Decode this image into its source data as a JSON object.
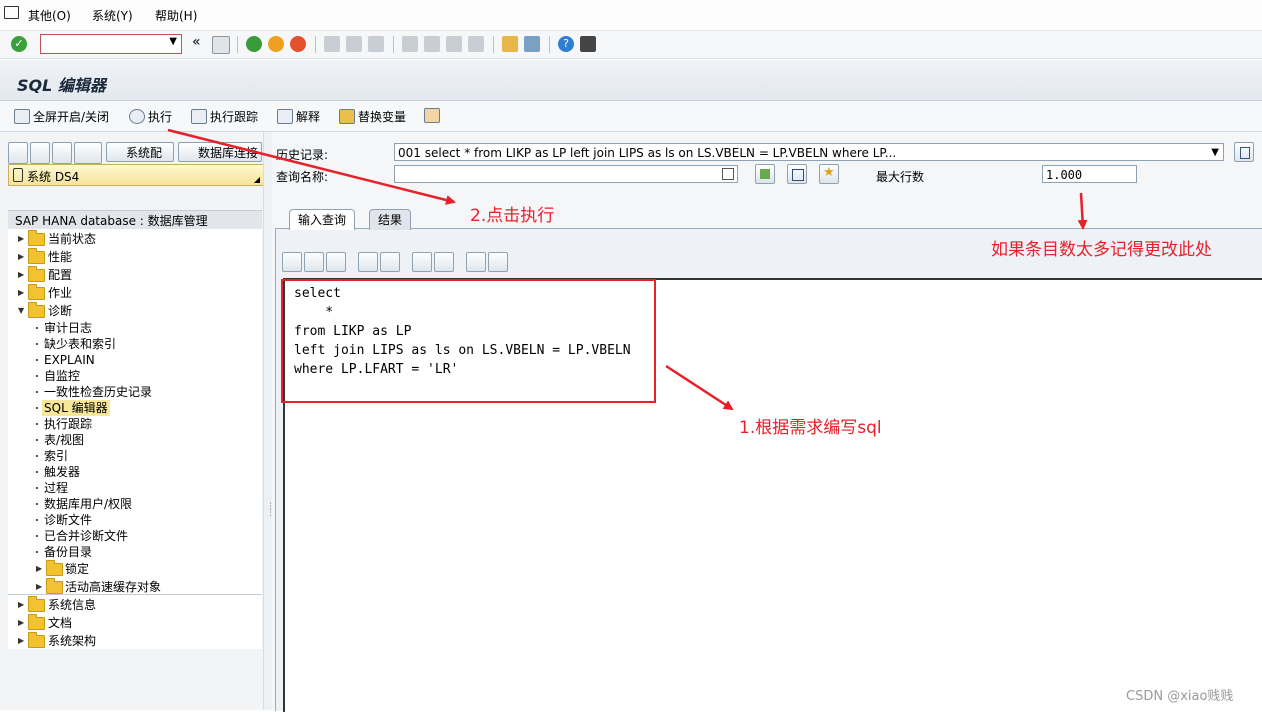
{
  "menu": {
    "items": [
      "其他(O)",
      "系统(Y)",
      "帮助(H)"
    ]
  },
  "command_field": {
    "value": ""
  },
  "title": "SQL 编辑器",
  "app_toolbar": {
    "buttons": [
      "全屏开启/关闭",
      "执行",
      "执行跟踪",
      "解释",
      "替换变量"
    ]
  },
  "left_toolbar": {
    "sys_config": "系统配置",
    "db_connect": "数据库连接"
  },
  "system": {
    "label": "系统 DS4"
  },
  "tree": {
    "header": "SAP HANA database : 数据库管理",
    "top_items": [
      "当前状态",
      "性能",
      "配置",
      "作业"
    ],
    "diagnosis_label": "诊断",
    "diagnosis_children": [
      "审计日志",
      "缺少表和索引",
      "EXPLAIN",
      "自监控",
      "一致性检查历史记录",
      "SQL 编辑器",
      "执行跟踪",
      "表/视图",
      "索引",
      "触发器",
      "过程",
      "数据库用户/权限",
      "诊断文件",
      "已合并诊断文件",
      "备份目录"
    ],
    "diagnosis_folders": [
      "锁定",
      "活动高速缓存对象"
    ],
    "bottom_items": [
      "系统信息",
      "文档",
      "系统架构"
    ]
  },
  "form": {
    "history_label": "历史记录:",
    "history_value": "001 select * from LIKP as LP left join LIPS as ls on LS.VBELN = LP.VBELN where LP...",
    "query_name_label": "查询名称:",
    "query_name_value": "",
    "max_rows_label": "最大行数",
    "max_rows_value": "1.000"
  },
  "tabs": [
    "输入查询",
    "结果"
  ],
  "editor": {
    "code": "select\n    *\nfrom LIKP as LP\nleft join LIPS as ls on LS.VBELN = LP.VBELN\nwhere LP.LFART = 'LR'"
  },
  "annotations": {
    "step2": "2.点击执行",
    "max_rows_note": "如果条目数太多记得更改此处",
    "step1": "1.根据需求编写sql",
    "color": "#e8202a"
  },
  "watermark": "CSDN @xiao贱贱"
}
